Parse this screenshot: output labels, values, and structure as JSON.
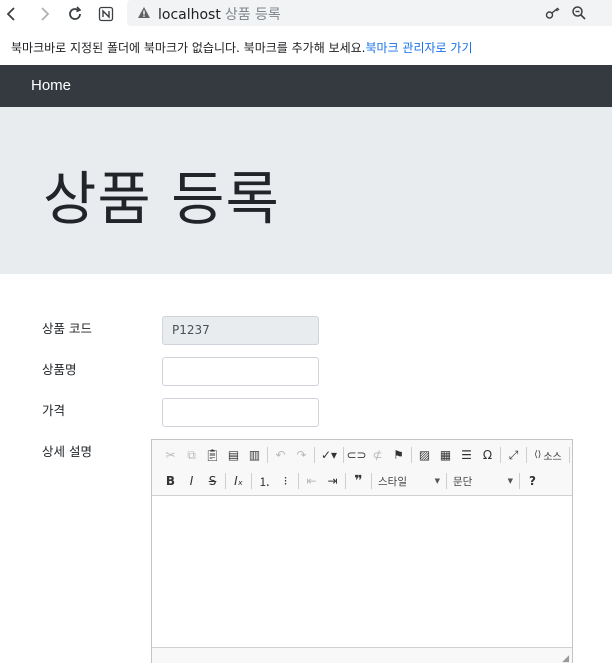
{
  "browser": {
    "url": "localhost",
    "page_title": "상품 등록"
  },
  "bookmarks": {
    "message": "북마크바로 지정된 폴더에 북마크가 없습니다. 북마크를 추가해 보세요.",
    "link": "북마크 관리자로 가기"
  },
  "navbar": {
    "home": "Home"
  },
  "jumbotron": {
    "title": "상품 등록"
  },
  "form": {
    "code_label": "상품 코드",
    "code_value": "P1237",
    "name_label": "상품명",
    "name_value": "",
    "price_label": "가격",
    "price_value": "",
    "desc_label": "상세 설명"
  },
  "editor": {
    "source_label": "소스",
    "style_combo": "스타일",
    "format_combo": "문단",
    "help_label": "?"
  }
}
